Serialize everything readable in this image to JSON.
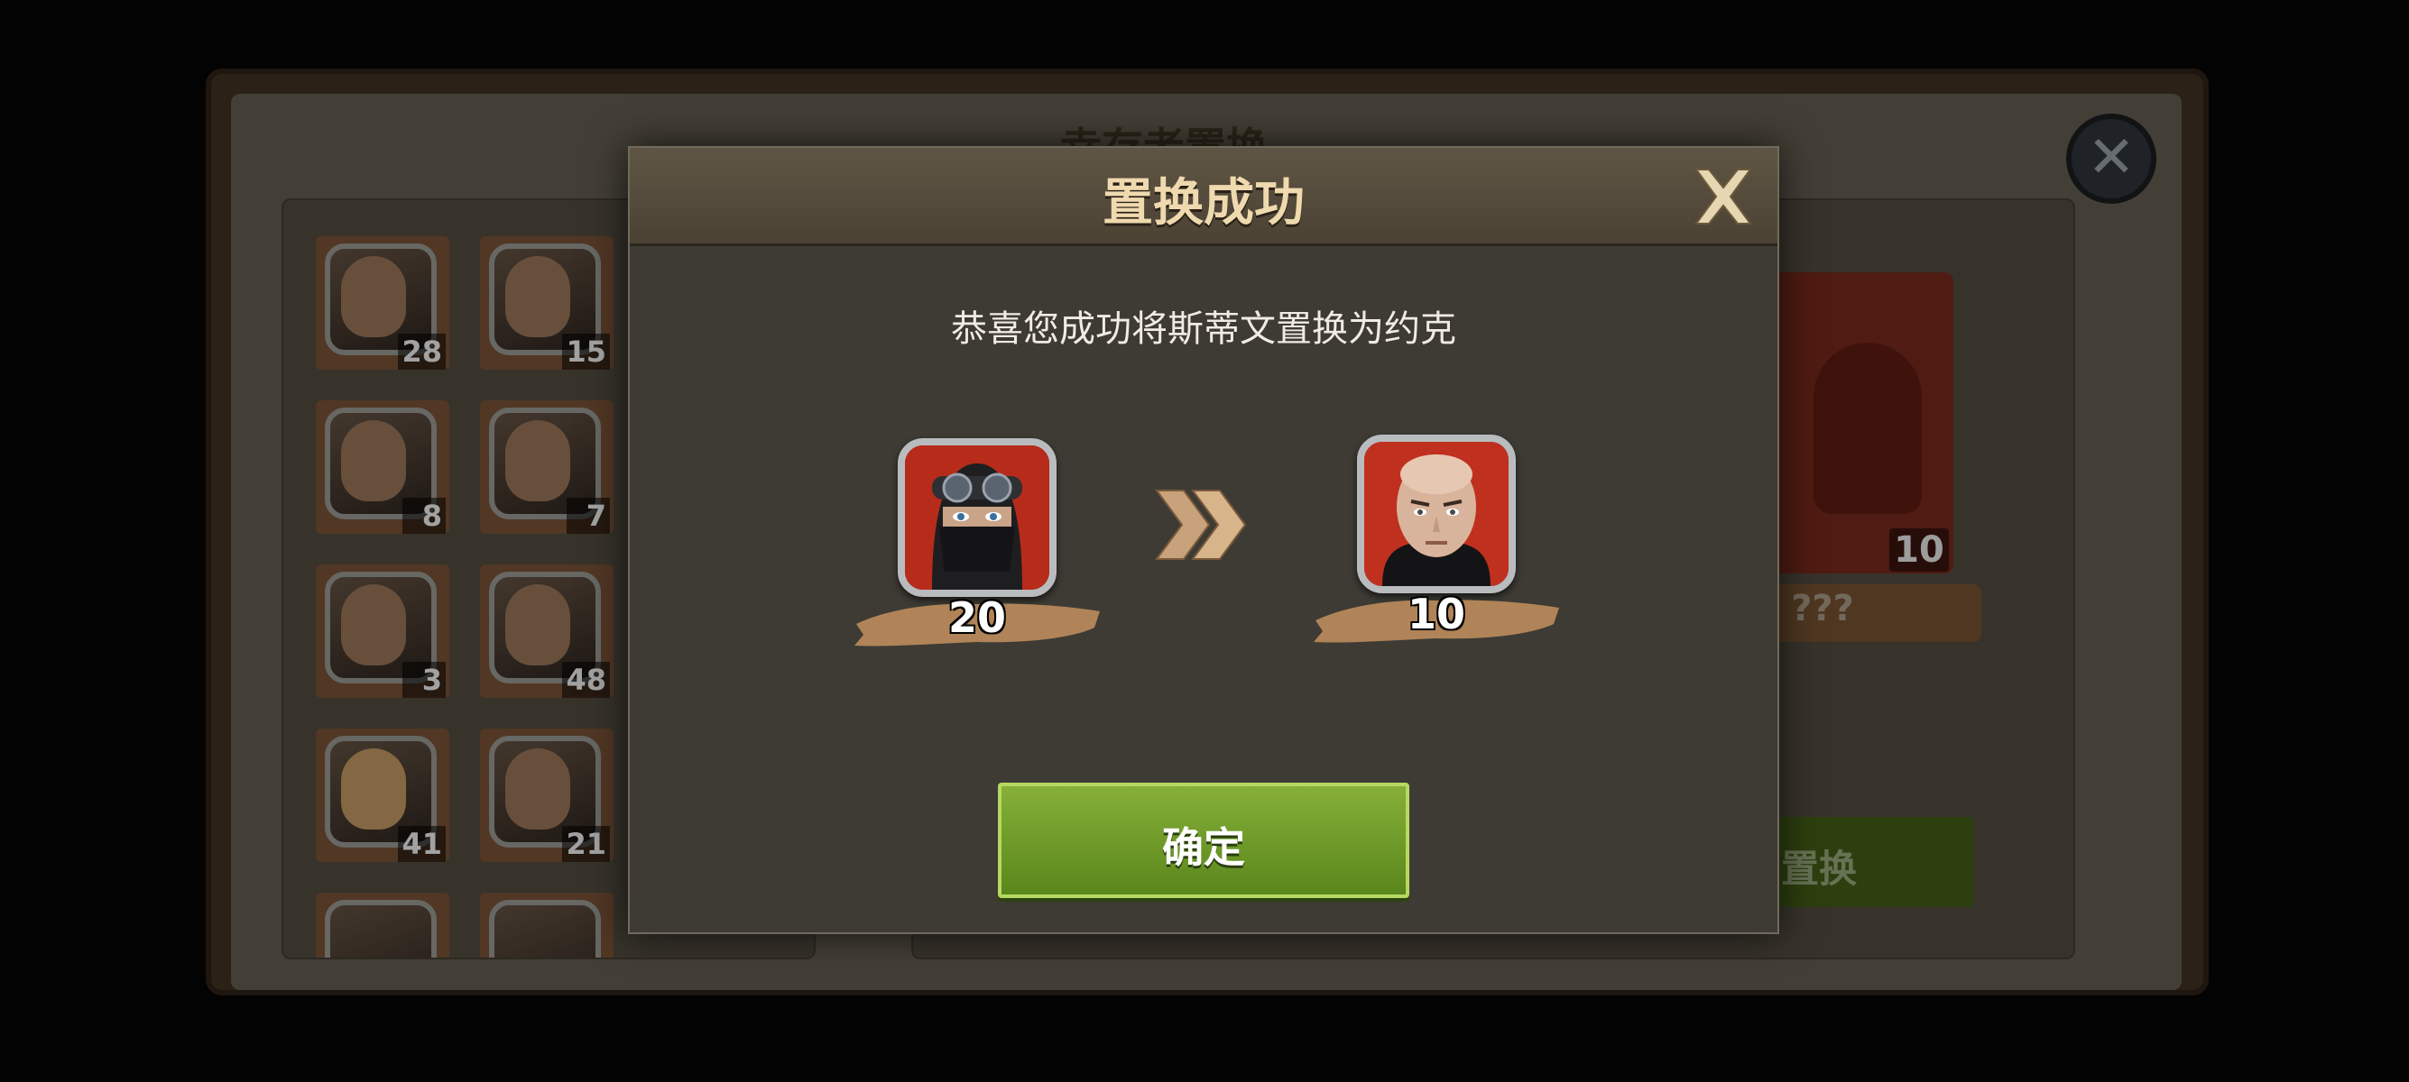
{
  "background": {
    "title": "幸存者置换",
    "close_icon": "close-icon",
    "roster": [
      {
        "count": "28"
      },
      {
        "count": "15"
      },
      {
        "count": "8"
      },
      {
        "count": "7"
      },
      {
        "count": "3"
      },
      {
        "count": "48"
      },
      {
        "count": "41"
      },
      {
        "count": "21"
      }
    ],
    "target": {
      "count": "10",
      "name": "???"
    },
    "swap_button_label": "置换"
  },
  "dialog": {
    "title": "置换成功",
    "close_icon": "close-x-icon",
    "message": "恭喜您成功将斯蒂文置换为约克",
    "from_hero": {
      "count": "20",
      "portrait": "masked-soldier-portrait"
    },
    "arrow_icon": "double-chevron-right-icon",
    "to_hero": {
      "count": "10",
      "portrait": "bald-soldier-portrait"
    },
    "confirm_label": "确定"
  },
  "colors": {
    "title_gold": "#efd9ae",
    "confirm_green": "#86b038",
    "banner_tan": "#b08458",
    "portrait_red": "#c0301e"
  }
}
